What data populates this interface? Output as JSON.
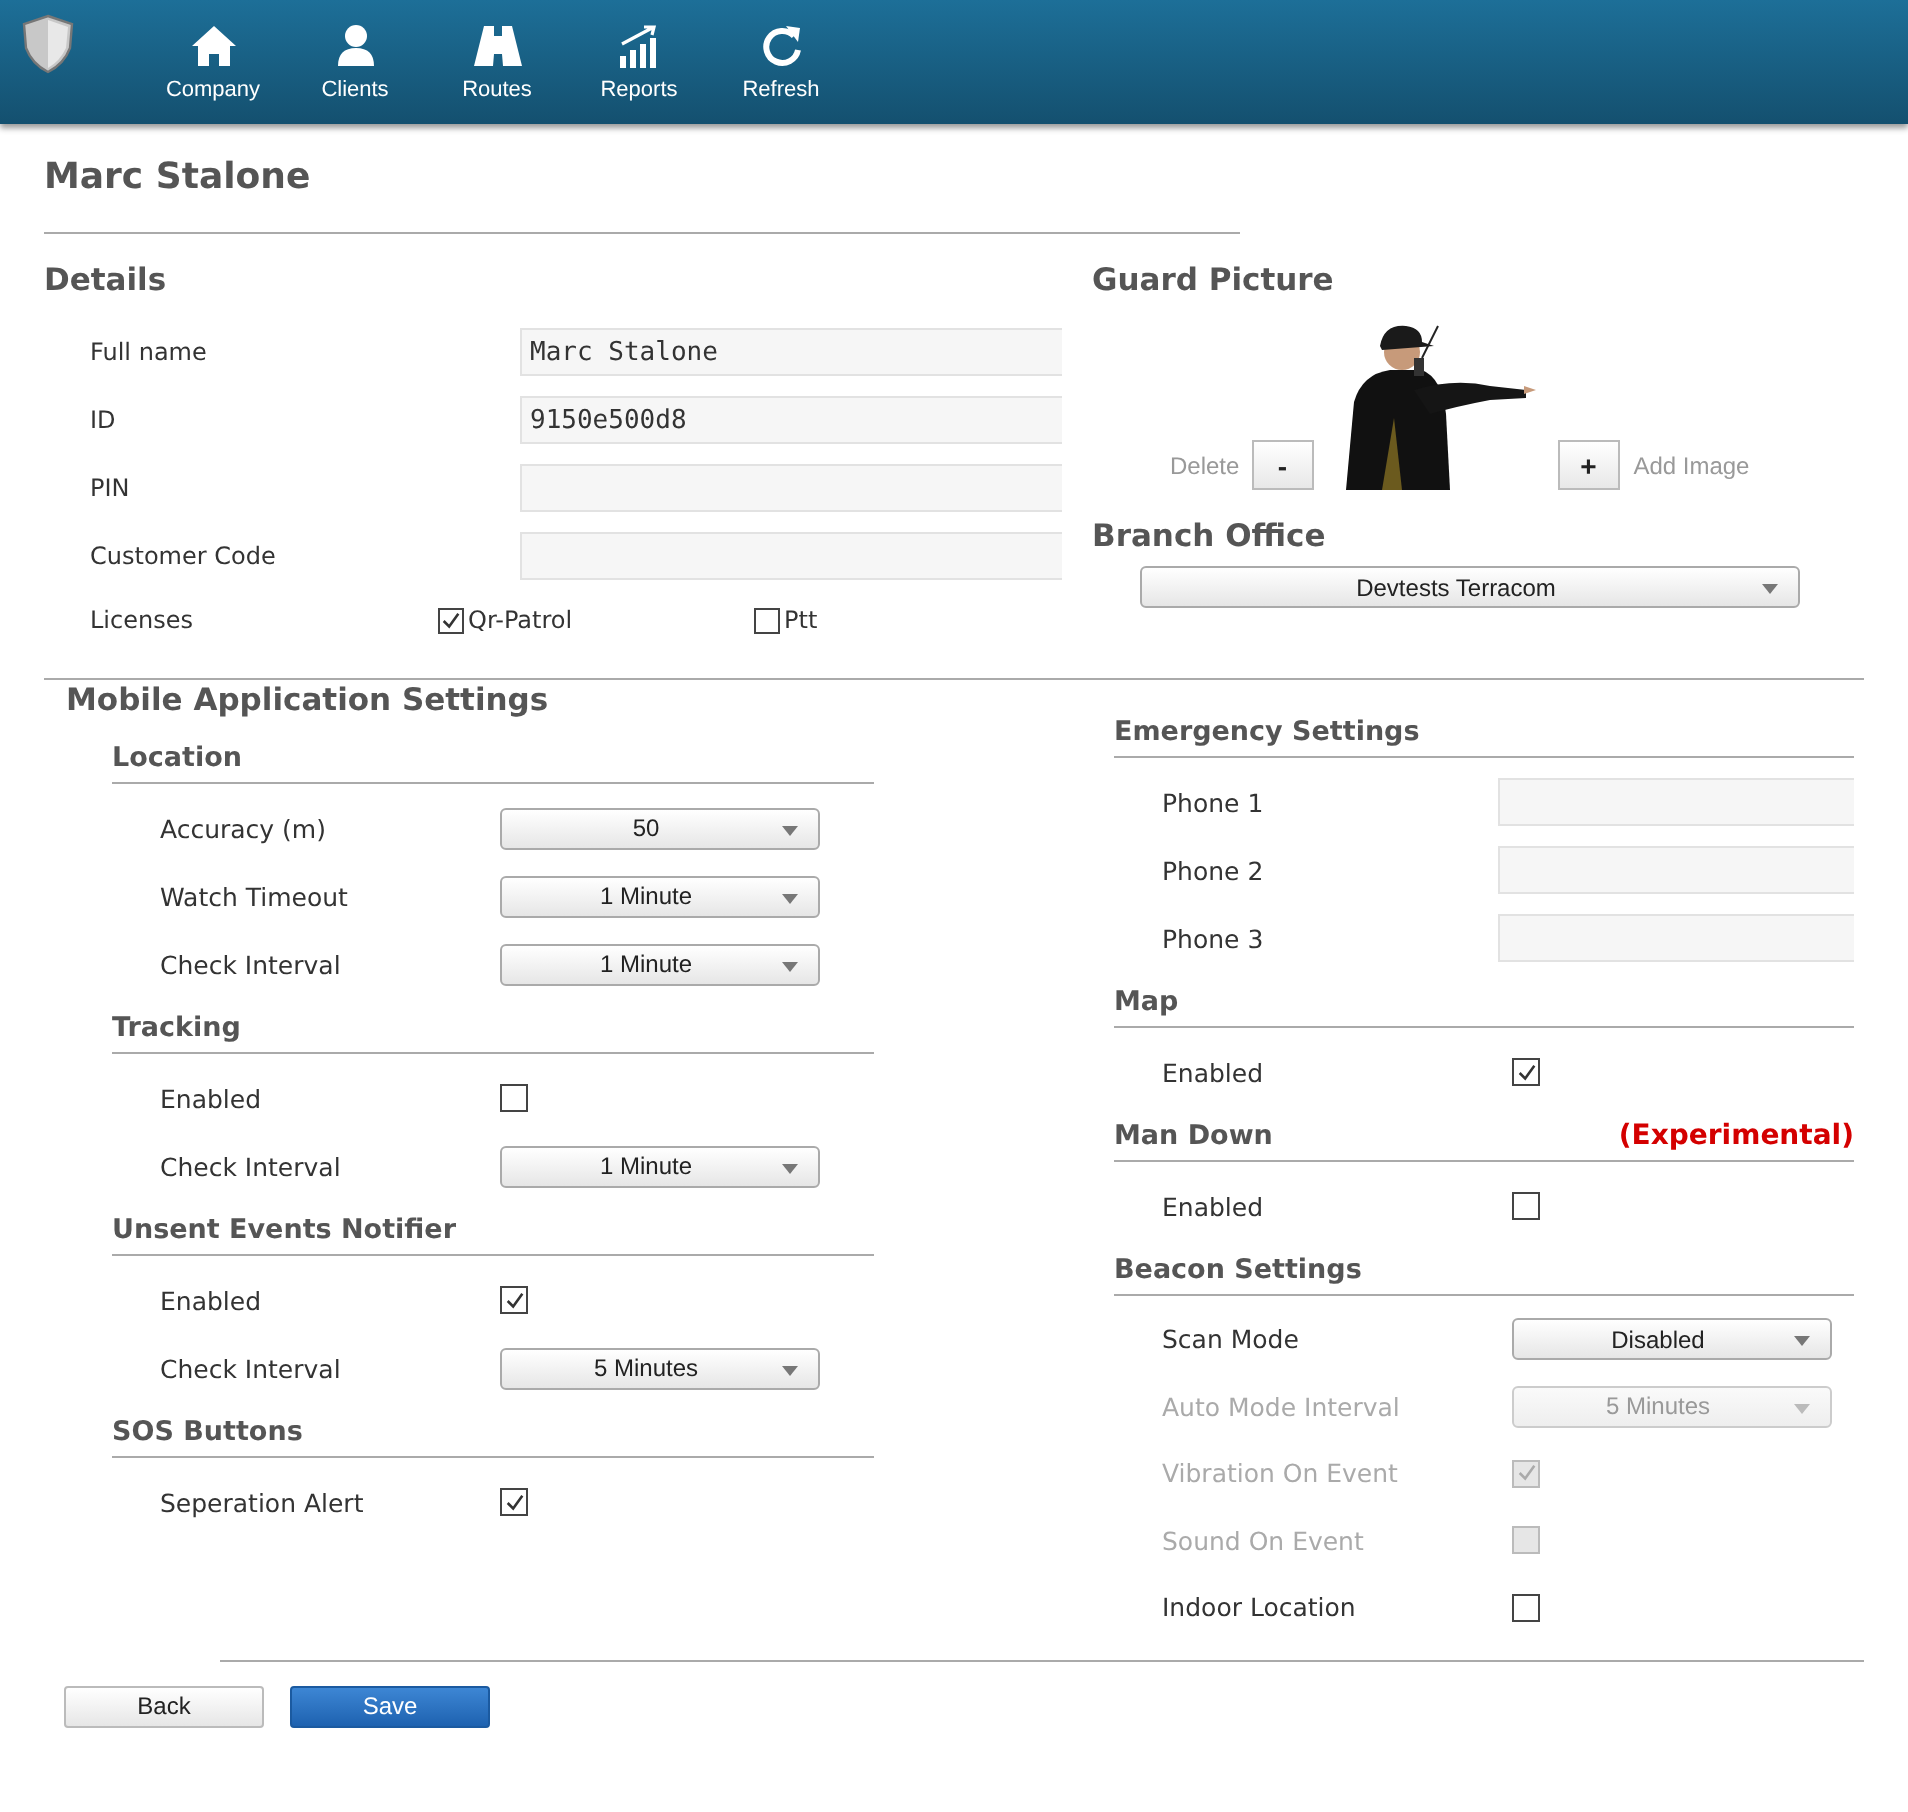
{
  "nav": {
    "items": [
      {
        "label": "Company"
      },
      {
        "label": "Clients"
      },
      {
        "label": "Routes"
      },
      {
        "label": "Reports"
      },
      {
        "label": "Refresh"
      }
    ]
  },
  "page_title": "Marc Stalone",
  "details": {
    "title": "Details",
    "fields": [
      {
        "label": "Full name",
        "value": "Marc Stalone"
      },
      {
        "label": "ID",
        "value": "9150e500d8"
      },
      {
        "label": "PIN"
      },
      {
        "label": "Customer Code"
      }
    ],
    "licenses": {
      "label": "Licenses",
      "options": [
        {
          "label": "Qr-Patrol",
          "checked": true
        },
        {
          "label": "Ptt",
          "checked": false
        }
      ]
    }
  },
  "guard_picture": {
    "title": "Guard Picture",
    "delete_label": "Delete",
    "remove_button": "-",
    "add_button": "+",
    "add_label": "Add Image"
  },
  "branch_office": {
    "title": "Branch Office",
    "value": "Devtests Terracom"
  },
  "mobile_settings": {
    "title": "Mobile Application Settings",
    "left": [
      {
        "title": "Location",
        "rows": [
          {
            "kind": "select",
            "label": "Accuracy (m)",
            "value": "50",
            "disabled": false
          },
          {
            "kind": "select",
            "label": "Watch Timeout",
            "value": "1 Minute",
            "disabled": false
          },
          {
            "kind": "select",
            "label": "Check Interval",
            "value": "1 Minute",
            "disabled": false
          }
        ]
      },
      {
        "title": "Tracking",
        "rows": [
          {
            "kind": "checkbox",
            "label": "Enabled",
            "checked": false,
            "disabled": false
          },
          {
            "kind": "select",
            "label": "Check Interval",
            "value": "1 Minute",
            "disabled": false
          }
        ]
      },
      {
        "title": "Unsent Events Notifier",
        "rows": [
          {
            "kind": "checkbox",
            "label": "Enabled",
            "checked": true,
            "disabled": false
          },
          {
            "kind": "select",
            "label": "Check Interval",
            "value": "5 Minutes",
            "disabled": false
          }
        ]
      },
      {
        "title": "SOS Buttons",
        "rows": [
          {
            "kind": "checkbox",
            "label": "Seperation Alert",
            "checked": true,
            "disabled": false
          }
        ]
      }
    ],
    "right": [
      {
        "title": "Emergency Settings",
        "rows": [
          {
            "kind": "text",
            "label": "Phone 1",
            "disabled": false
          },
          {
            "kind": "text",
            "label": "Phone 2",
            "disabled": false
          },
          {
            "kind": "text",
            "label": "Phone 3",
            "disabled": false
          }
        ]
      },
      {
        "title": "Map",
        "rows": [
          {
            "kind": "checkbox",
            "label": "Enabled",
            "checked": true,
            "disabled": false
          }
        ]
      },
      {
        "title": "Man Down",
        "note": "(Experimental)",
        "rows": [
          {
            "kind": "checkbox",
            "label": "Enabled",
            "checked": false,
            "disabled": false
          }
        ]
      },
      {
        "title": "Beacon Settings",
        "rows": [
          {
            "kind": "select",
            "label": "Scan Mode",
            "value": "Disabled",
            "disabled": false
          },
          {
            "kind": "select",
            "label": "Auto Mode Interval",
            "value": "5 Minutes",
            "disabled": true
          },
          {
            "kind": "checkbox",
            "label": "Vibration On Event",
            "checked": true,
            "disabled": true
          },
          {
            "kind": "checkbox",
            "label": "Sound On Event",
            "checked": false,
            "disabled": true
          },
          {
            "kind": "checkbox",
            "label": "Indoor Location",
            "checked": false,
            "disabled": false
          }
        ]
      }
    ]
  },
  "buttons": [
    {
      "label": "Back",
      "primary": false
    },
    {
      "label": "Save",
      "primary": true
    }
  ]
}
